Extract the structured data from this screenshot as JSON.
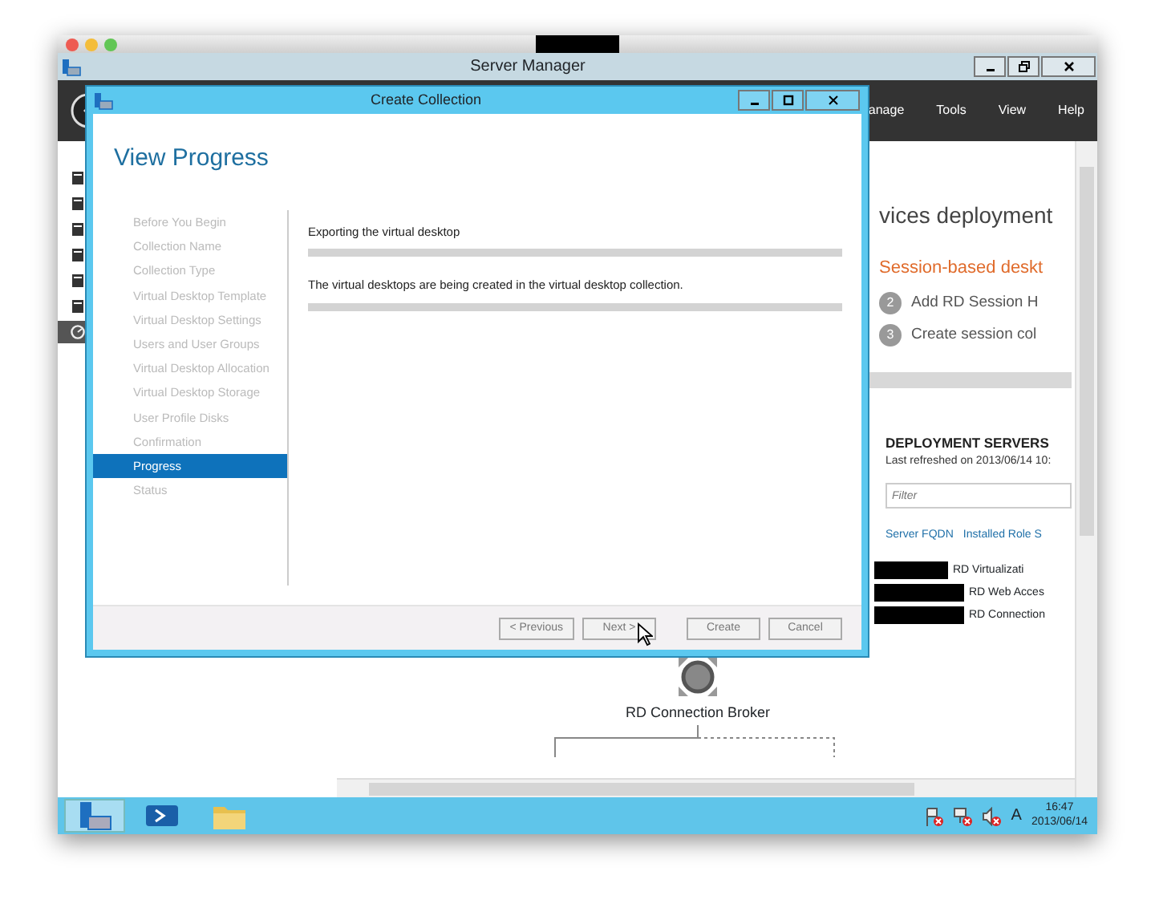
{
  "app_window": {
    "title": "Server Manager"
  },
  "menu": [
    "anage",
    "Tools",
    "View",
    "Help"
  ],
  "sidebar": {
    "items": [
      {
        "selected": false
      },
      {
        "selected": false
      },
      {
        "selected": false
      },
      {
        "selected": false
      },
      {
        "selected": false
      },
      {
        "selected": false
      },
      {
        "selected": true
      }
    ]
  },
  "overview": {
    "heading": "vices deployment",
    "scenario": "Session-based deskt",
    "steps": [
      {
        "number": "2",
        "label": "Add RD Session H"
      },
      {
        "number": "3",
        "label": "Create session col"
      }
    ]
  },
  "deployment_servers": {
    "title": "DEPLOYMENT SERVERS",
    "refreshed": "Last refreshed on 2013/06/14 10:",
    "filter": {
      "placeholder": "Filter"
    },
    "columns": [
      "Server FQDN",
      "Installed Role S"
    ],
    "rows": [
      {
        "role": "RD Virtualizati"
      },
      {
        "role": "RD Web Acces"
      },
      {
        "role": "RD Connection"
      }
    ]
  },
  "diagram": {
    "node": "RD Connection Broker"
  },
  "dialog": {
    "title": "Create Collection",
    "heading": "View Progress",
    "steps": [
      {
        "label": "Before You Begin",
        "selected": false
      },
      {
        "label": "Collection Name",
        "selected": false
      },
      {
        "label": "Collection Type",
        "selected": false
      },
      {
        "label": "Virtual Desktop Template",
        "selected": false
      },
      {
        "label": "Virtual Desktop Settings",
        "selected": false
      },
      {
        "label": "Users and User Groups",
        "selected": false
      },
      {
        "label": "Virtual Desktop Allocation",
        "selected": false
      },
      {
        "label": "Virtual Desktop Storage",
        "selected": false
      },
      {
        "label": "User Profile Disks",
        "selected": false
      },
      {
        "label": "Confirmation",
        "selected": false
      },
      {
        "label": "Progress",
        "selected": true
      },
      {
        "label": "Status",
        "selected": false
      }
    ],
    "tasks": [
      {
        "label": "Exporting the virtual desktop",
        "level": 0
      },
      {
        "label": "The virtual desktops are being created in the virtual desktop collection.",
        "level": 0
      }
    ],
    "buttons": [
      "< Previous",
      "Next >",
      "Create",
      "Cancel"
    ]
  },
  "taskbar": {
    "apps": [
      {
        "kind": "server-manager",
        "selected": true
      },
      {
        "kind": "powershell",
        "selected": false
      },
      {
        "kind": "explorer",
        "selected": false
      }
    ],
    "input_indicator": "A",
    "time": "16:47",
    "date": "2013/06/14"
  }
}
